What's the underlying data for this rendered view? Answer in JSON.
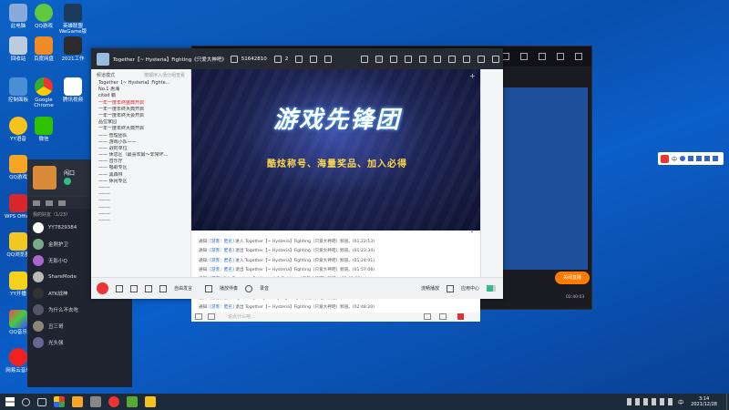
{
  "desktop_icons": [
    {
      "label": "此电脑"
    },
    {
      "label": "QQ游戏"
    },
    {
      "label": "英雄联盟WeGame版"
    },
    {
      "label": "回收站"
    },
    {
      "label": "百度网盘"
    },
    {
      "label": "2021工作"
    },
    {
      "label": "控制面板"
    },
    {
      "label": "Google Chrome"
    },
    {
      "label": "YY语音"
    },
    {
      "label": "QQ音乐"
    },
    {
      "label": "微信"
    },
    {
      "label": "腾讯视频"
    },
    {
      "label": "QQ游戏"
    },
    {
      "label": "WPS Office"
    },
    {
      "label": "QQ浏览器"
    },
    {
      "label": "YY开播"
    },
    {
      "label": "网易云音乐"
    }
  ],
  "left_panel": {
    "username": "闯口",
    "section": "我的好友（1/23）",
    "friends": [
      "YY7829384",
      "金刚护卫",
      "无影小Q",
      "ShareMode",
      "ATK战神",
      "为什么不去吃",
      "丑三哥",
      "光头强"
    ]
  },
  "main_window": {
    "title": "Together【~ Hysteria】Fighting《只爱大神吧》",
    "channel_id": "51642810",
    "user_count": "2",
    "sidebar_header": "频道模式",
    "sidebar_note": "按顺序入场分组查看",
    "sidebar_rows": [
      {
        "text": "Together【~ Hysteria】Fighte...",
        "red": false
      },
      {
        "text": "  No.1·惠海",
        "red": false
      },
      {
        "text": "  cited 霸",
        "red": false
      },
      {
        "text": "一年一度年终盛典开启",
        "red": true
      },
      {
        "text": "一年一度年终大典开启",
        "red": false
      },
      {
        "text": "一年一度年终大会开启",
        "red": false
      },
      {
        "text": "品位家园",
        "red": false
      },
      {
        "text": "一年一度年终大典开启",
        "red": false
      },
      {
        "text": "—— 管理团队",
        "red": false
      },
      {
        "text": "—— 游戏小队——",
        "red": false
      },
      {
        "text": "—— 战时单位",
        "red": false
      },
      {
        "text": "  —— 休息区（最喜欢最～非常坏…",
        "red": false
      },
      {
        "text": "—— 音乐厅",
        "red": false
      },
      {
        "text": "—— 唱歌专区",
        "red": false
      },
      {
        "text": "—— 黑森林",
        "red": false
      },
      {
        "text": "—— 休闲专区",
        "red": false
      },
      {
        "text": "-------",
        "red": false
      },
      {
        "text": "-------",
        "red": false
      },
      {
        "text": "-------",
        "red": false
      },
      {
        "text": "-------",
        "red": false
      },
      {
        "text": "-------",
        "red": false
      },
      {
        "text": "-------",
        "red": false
      }
    ],
    "banner_title": "游戏先锋团",
    "banner_tagline": "酷炫称号、海量奖品、加入必得",
    "messages": [
      {
        "label": "通知:",
        "user": "[游客：匿名]",
        "text": "进入 Together【~ Hysteria】Fighting（只爱大神吧）频道。(01:22:13)"
      },
      {
        "label": "通知:",
        "user": "[游客：匿名]",
        "text": "退出 Together【~ Hysteria】Fighting（只爱大神吧）频道。(01:23:34)"
      },
      {
        "label": "通知:",
        "user": "[游客：匿名]",
        "text": "进入 Together【~ Hysteria】Fighting（只爱大神吧）频道。(01:24:01)"
      },
      {
        "label": "通知:",
        "user": "[游客：匿名]",
        "text": "退出 Together【~ Hysteria】Fighting（只爱大神吧）频道。(01:57:06)"
      },
      {
        "label": "通知:",
        "user": "[游客]",
        "text": "进入 Together【~ Hysteria】Fighting（只爱大神吧）频道。(02:09:32)"
      },
      {
        "label": "通知:",
        "user": "[游客]",
        "text": "退出 Together【~ Hysteria】Fighting（只爱大神吧）频道。(02:13:40)"
      },
      {
        "label": "通知:",
        "user": "[游客]",
        "text": "进入 Together【~ Hysteria】Fighting（只爱大神吧）频道。(02:37:40)"
      },
      {
        "label": "通知:",
        "user": "[游客：匿名]",
        "text": "退出 Together【~ Hysteria】Fighting（只爱大神吧）频道。(02:48:20)"
      }
    ],
    "input_placeholder": "说点什么吧...",
    "bottom": {
      "mode": "自由发言",
      "play": "播放伴奏",
      "record": "录音",
      "quality": "流畅播放",
      "app": "应用中心"
    }
  },
  "dark_window": {
    "footer_left": "直播间主播，赠送礼物支持TA吧",
    "footer_btn": "关闭直播",
    "time": "02:40:03"
  },
  "ime": {
    "label": "中"
  },
  "taskbar": {
    "time": "3:14",
    "date": "2021/12/28",
    "lang": "中"
  },
  "colors": {
    "accent": "#ff7a00",
    "link": "#2a6fd1",
    "taskbar": "#1d2a3a"
  }
}
